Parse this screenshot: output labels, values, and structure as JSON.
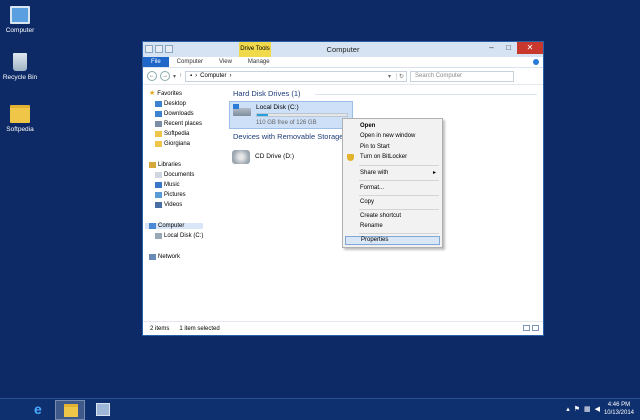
{
  "desktop": {
    "icons": [
      {
        "label": "Computer",
        "icon": "computer-icon"
      },
      {
        "label": "Recycle Bin",
        "icon": "recycle-bin-icon"
      },
      {
        "label": "Softpedia",
        "icon": "folder-icon"
      }
    ]
  },
  "window": {
    "title": "Computer",
    "contextual_tab": "Drive Tools",
    "ribbon_tabs": [
      "File",
      "Computer",
      "View",
      "Manage"
    ],
    "address_path": "Computer",
    "search_placeholder": "Search Computer",
    "nav": {
      "favorites": "Favorites",
      "favorites_items": [
        "Desktop",
        "Downloads",
        "Recent places",
        "Softpedia",
        "Giorgiana"
      ],
      "libraries": "Libraries",
      "libraries_items": [
        "Documents",
        "Music",
        "Pictures",
        "Videos"
      ],
      "computer": "Computer",
      "computer_items": [
        "Local Disk (C:)"
      ],
      "network": "Network"
    },
    "content": {
      "hdd_group": "Hard Disk Drives (1)",
      "local_disk": {
        "name": "Local Disk (C:)",
        "space": "110 GB free of 126 GB",
        "used_fraction": 0.127
      },
      "removable_group": "Devices with Removable Storage (",
      "cd_drive": "CD Drive (D:)"
    },
    "status": {
      "items": "2 items",
      "selected": "1 item selected"
    }
  },
  "context_menu": {
    "items": [
      "Open",
      "Open in new window",
      "Pin to Start",
      "Turn on BitLocker",
      "Share with",
      "Format...",
      "Copy",
      "Create shortcut",
      "Rename",
      "Properties"
    ]
  },
  "taskbar": {
    "time": "4:46 PM",
    "date": "10/13/2014"
  },
  "colors": {
    "desktop": "#0d2a66",
    "taskbar": "#0f306f",
    "file_tab": "#1e67c9",
    "drive_tools": "#f0d94a",
    "close_button": "#c8382d",
    "storage_bar": "#26a0da"
  }
}
